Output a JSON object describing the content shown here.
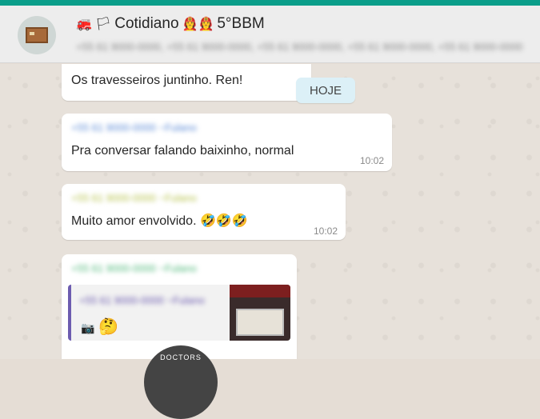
{
  "header": {
    "chat_name": "Cotidiano",
    "emoji_left": "🚒",
    "emoji_mid": "🏳",
    "emoji_right": "👩‍🚒👩‍🚒",
    "suffix": "5°BBM",
    "participants": "+55 61 9000-0000, +55 61 9000-0000, +55 61 9000-0000, +55 61 9000-0000, +55 61 9000-0000"
  },
  "day_chip": "HOJE",
  "messages": [
    {
      "sender": "",
      "text": "Os travesseiros juntinho. Ren!",
      "time": ""
    },
    {
      "sender": "+55 61 9000-0000 ~Fulano",
      "text": "Pra conversar falando baixinho, normal",
      "time": "10:02"
    },
    {
      "sender": "+55 61 9000-0000 ~Fulano",
      "text": "Muito amor envolvido. 🤣🤣🤣",
      "time": "10:02"
    },
    {
      "sender": "+55 61 9000-0000 ~Fulano",
      "quote_sender": "+55 61 9000-0000 ~Fulano",
      "quote_emoji": "🤔"
    }
  ],
  "watermark": "DOCTORS",
  "colors": {
    "top_bar": "#0a9e8a",
    "header_bg": "#ededed",
    "quote_accent": "#6d5cb0",
    "chip_bg": "#dcf0f7"
  }
}
